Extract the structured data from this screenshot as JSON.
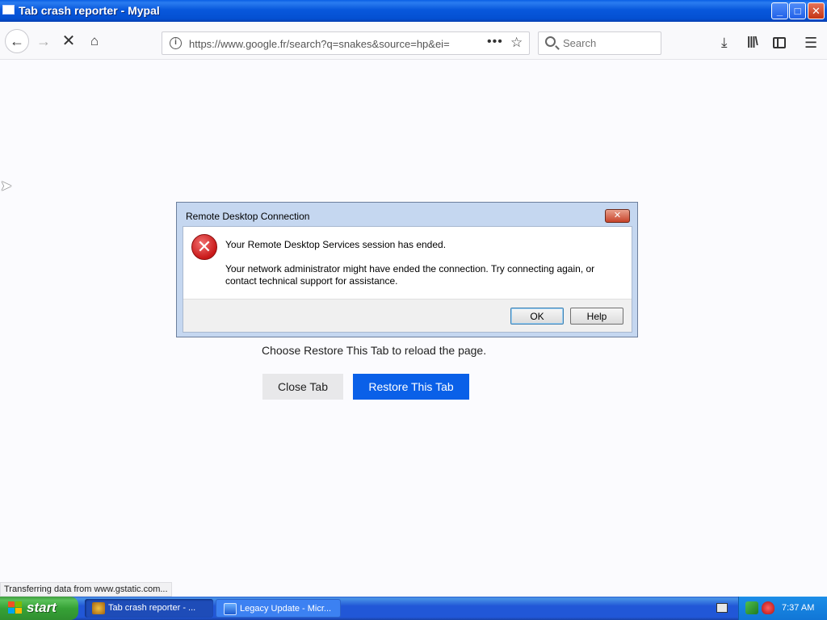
{
  "window": {
    "title": "Tab crash reporter - Mypal",
    "minimize_glyph": "_",
    "maximize_glyph": "□",
    "close_glyph": "✕"
  },
  "toolbar": {
    "back_glyph": "←",
    "forward_glyph": "→",
    "stop_glyph": "✕",
    "home_glyph": "⌂",
    "url": "https://www.google.fr/search?q=snakes&source=hp&ei=",
    "page_actions_glyph": "•••",
    "bookmark_glyph": "☆",
    "search_placeholder": "Search",
    "download_glyph": "⤓",
    "library_glyph": "|||\\",
    "menu_glyph": "☰"
  },
  "crash_page": {
    "instruction": "Choose Restore This Tab to reload the page.",
    "close_tab_label": "Close Tab",
    "restore_tab_label": "Restore This Tab"
  },
  "dialog": {
    "title": "Remote Desktop Connection",
    "close_glyph": "✕",
    "error_glyph": "✕",
    "message": "Your Remote Desktop Services session has ended.",
    "detail": "Your network administrator might have ended the connection. Try connecting again, or contact technical support for assistance.",
    "ok_label": "OK",
    "help_label": "Help"
  },
  "statusbar": {
    "text": "Transferring data from www.gstatic.com..."
  },
  "taskbar": {
    "start_label": "start",
    "tasks": [
      {
        "label": "Tab crash reporter - ...",
        "icon": "mypal-icon",
        "active": true
      },
      {
        "label": "Legacy Update - Micr...",
        "icon": "ie-icon",
        "active": false
      }
    ],
    "clock": "7:37 AM"
  },
  "colors": {
    "accent_blue": "#0a60e8",
    "xp_titlebar": "#0858dc",
    "xp_start_green": "#36a236",
    "error_red": "#c81818"
  }
}
